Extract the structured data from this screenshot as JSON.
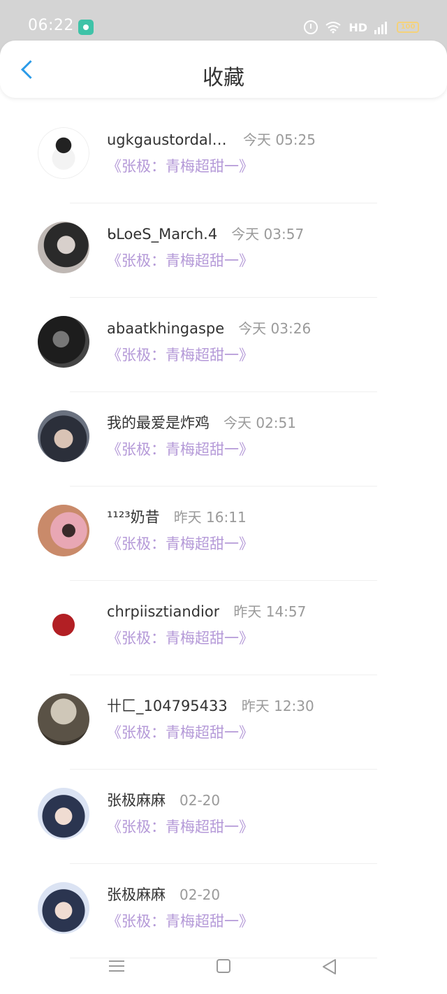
{
  "status_bar": {
    "time": "06:22",
    "network": "HD",
    "signal": "4G",
    "battery": "100"
  },
  "nav": {
    "title": "收藏"
  },
  "favorites": [
    {
      "name": "ugkgaustordalr...",
      "time": "今天 05:25",
      "book": "《张极：青梅超甜一》",
      "avatar_icon": "cartoon-girl-avatar"
    },
    {
      "name": "ᑲLoeS_March.4",
      "time": "今天 03:57",
      "book": "《张极：青梅超甜一》",
      "avatar_icon": "girl-photo-avatar"
    },
    {
      "name": "abaatkhingaspe",
      "time": "今天 03:26",
      "book": "《张极：青梅超甜一》",
      "avatar_icon": "bw-photo-avatar"
    },
    {
      "name": "我的最爱是炸鸡",
      "time": "今天 02:51",
      "book": "《张极：青梅超甜一》",
      "avatar_icon": "boy-photo-avatar"
    },
    {
      "name": "¹¹²³奶昔",
      "time": "昨天 16:11",
      "book": "《张极：青梅超甜一》",
      "avatar_icon": "pink-photo-avatar"
    },
    {
      "name": "chrpiisztiandior",
      "time": "昨天 14:57",
      "book": "《张极：青梅超甜一》",
      "avatar_icon": "rooster-avatar"
    },
    {
      "name": "卄匚_104795433",
      "time": "昨天 12:30",
      "book": "《张极：青梅超甜一》",
      "avatar_icon": "umbrella-photo-avatar"
    },
    {
      "name": "张极麻麻",
      "time": "02-20",
      "book": "《张极：青梅超甜一》",
      "avatar_icon": "boy-portrait-avatar"
    },
    {
      "name": "张极麻麻",
      "time": "02-20",
      "book": "《张极：青梅超甜一》",
      "avatar_icon": "boy-portrait-avatar"
    }
  ],
  "colors": {
    "accent": "#2b9be8",
    "book_title": "#b59ad8",
    "status_bar": "#d4d4d4"
  }
}
